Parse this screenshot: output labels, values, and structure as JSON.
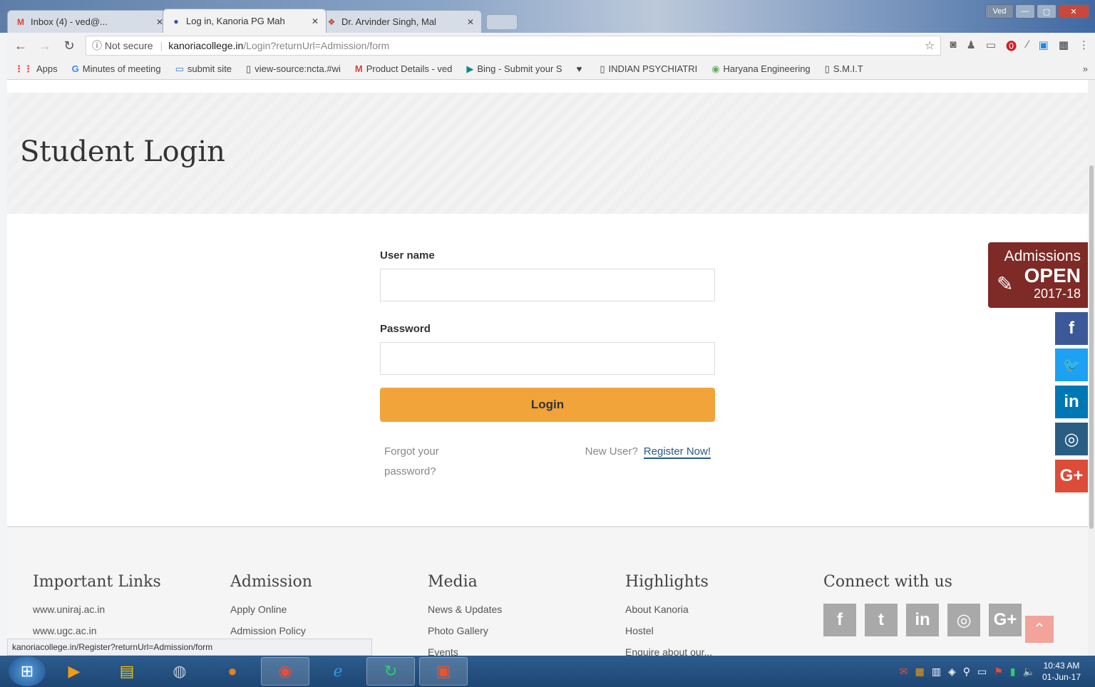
{
  "browser": {
    "tabs": [
      {
        "title": "Inbox (4) - ved@...",
        "icon": "M"
      },
      {
        "title": "Log in, Kanoria PG Mah",
        "icon": "●"
      },
      {
        "title": "Dr. Arvinder Singh, Mal",
        "icon": "❖"
      }
    ],
    "window_user": "Ved",
    "address": {
      "secure_label": "Not secure",
      "host": "kanoriacollege.in",
      "path": "/Login?returnUrl=Admission/form"
    },
    "bookmarks": [
      {
        "label": "Apps",
        "icon": "⋮⋮"
      },
      {
        "label": "Minutes of meeting",
        "icon": "G"
      },
      {
        "label": "submit site",
        "icon": "▭"
      },
      {
        "label": "view-source:ncta.#wi",
        "icon": "▯"
      },
      {
        "label": "Product Details - ved",
        "icon": "M"
      },
      {
        "label": "Bing - Submit your S",
        "icon": "▶"
      },
      {
        "label": "",
        "icon": "♥"
      },
      {
        "label": "INDIAN PSYCHIATRI",
        "icon": "▯"
      },
      {
        "label": "Haryana Engineering",
        "icon": "◉"
      },
      {
        "label": "S.M.I.T",
        "icon": "▯"
      }
    ]
  },
  "page": {
    "title": "Student Login",
    "form": {
      "username_label": "User name",
      "username_value": "",
      "password_label": "Password",
      "password_value": "",
      "login_label": "Login",
      "forgot_label": "Forgot your password?",
      "new_user_label": "New User?",
      "register_label": "Register Now!"
    },
    "admissions_badge": {
      "line1": "Admissions",
      "line2": "OPEN",
      "line3": "2017-18"
    },
    "social_side": [
      {
        "name": "facebook",
        "glyph": "f",
        "color": "#3b5998"
      },
      {
        "name": "twitter",
        "glyph": "🐦",
        "color": "#1da1f2"
      },
      {
        "name": "linkedin",
        "glyph": "in",
        "color": "#0077b5"
      },
      {
        "name": "instagram",
        "glyph": "◎",
        "color": "#2a5d84"
      },
      {
        "name": "google-plus",
        "glyph": "G+",
        "color": "#dd4b39"
      }
    ],
    "footer": {
      "important_links": {
        "heading": "Important Links",
        "items": [
          "www.uniraj.ac.in",
          "www.ugc.ac.in"
        ]
      },
      "admission": {
        "heading": "Admission",
        "items": [
          "Apply Online",
          "Admission Policy"
        ]
      },
      "media": {
        "heading": "Media",
        "items": [
          "News & Updates",
          "Photo Gallery",
          "Events"
        ]
      },
      "highlights": {
        "heading": "Highlights",
        "items": [
          "About Kanoria",
          "Hostel",
          "Enquire about our..."
        ]
      },
      "connect": {
        "heading": "Connect with us",
        "icons": [
          "f",
          "t",
          "in",
          "◎",
          "G+"
        ]
      }
    },
    "status_url": "kanoriacollege.in/Register?returnUrl=Admission/form"
  },
  "taskbar": {
    "time": "10:43 AM",
    "date": "01-Jun-17"
  }
}
